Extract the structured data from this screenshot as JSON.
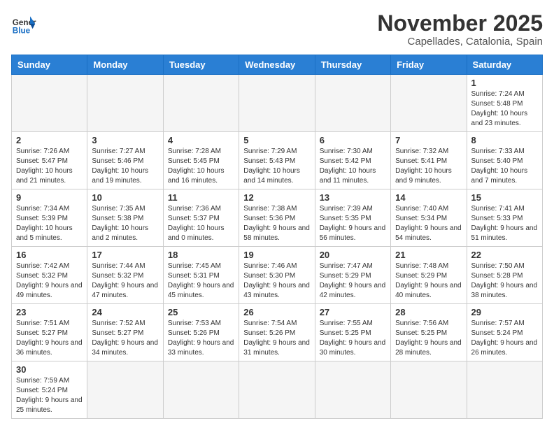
{
  "logo": {
    "text_general": "General",
    "text_blue": "Blue"
  },
  "title": {
    "month_year": "November 2025",
    "location": "Capellades, Catalonia, Spain"
  },
  "days_of_week": [
    "Sunday",
    "Monday",
    "Tuesday",
    "Wednesday",
    "Thursday",
    "Friday",
    "Saturday"
  ],
  "weeks": [
    [
      {
        "day": null,
        "info": null
      },
      {
        "day": null,
        "info": null
      },
      {
        "day": null,
        "info": null
      },
      {
        "day": null,
        "info": null
      },
      {
        "day": null,
        "info": null
      },
      {
        "day": null,
        "info": null
      },
      {
        "day": "1",
        "info": "Sunrise: 7:24 AM\nSunset: 5:48 PM\nDaylight: 10 hours and 23 minutes."
      }
    ],
    [
      {
        "day": "2",
        "info": "Sunrise: 7:26 AM\nSunset: 5:47 PM\nDaylight: 10 hours and 21 minutes."
      },
      {
        "day": "3",
        "info": "Sunrise: 7:27 AM\nSunset: 5:46 PM\nDaylight: 10 hours and 19 minutes."
      },
      {
        "day": "4",
        "info": "Sunrise: 7:28 AM\nSunset: 5:45 PM\nDaylight: 10 hours and 16 minutes."
      },
      {
        "day": "5",
        "info": "Sunrise: 7:29 AM\nSunset: 5:43 PM\nDaylight: 10 hours and 14 minutes."
      },
      {
        "day": "6",
        "info": "Sunrise: 7:30 AM\nSunset: 5:42 PM\nDaylight: 10 hours and 11 minutes."
      },
      {
        "day": "7",
        "info": "Sunrise: 7:32 AM\nSunset: 5:41 PM\nDaylight: 10 hours and 9 minutes."
      },
      {
        "day": "8",
        "info": "Sunrise: 7:33 AM\nSunset: 5:40 PM\nDaylight: 10 hours and 7 minutes."
      }
    ],
    [
      {
        "day": "9",
        "info": "Sunrise: 7:34 AM\nSunset: 5:39 PM\nDaylight: 10 hours and 5 minutes."
      },
      {
        "day": "10",
        "info": "Sunrise: 7:35 AM\nSunset: 5:38 PM\nDaylight: 10 hours and 2 minutes."
      },
      {
        "day": "11",
        "info": "Sunrise: 7:36 AM\nSunset: 5:37 PM\nDaylight: 10 hours and 0 minutes."
      },
      {
        "day": "12",
        "info": "Sunrise: 7:38 AM\nSunset: 5:36 PM\nDaylight: 9 hours and 58 minutes."
      },
      {
        "day": "13",
        "info": "Sunrise: 7:39 AM\nSunset: 5:35 PM\nDaylight: 9 hours and 56 minutes."
      },
      {
        "day": "14",
        "info": "Sunrise: 7:40 AM\nSunset: 5:34 PM\nDaylight: 9 hours and 54 minutes."
      },
      {
        "day": "15",
        "info": "Sunrise: 7:41 AM\nSunset: 5:33 PM\nDaylight: 9 hours and 51 minutes."
      }
    ],
    [
      {
        "day": "16",
        "info": "Sunrise: 7:42 AM\nSunset: 5:32 PM\nDaylight: 9 hours and 49 minutes."
      },
      {
        "day": "17",
        "info": "Sunrise: 7:44 AM\nSunset: 5:32 PM\nDaylight: 9 hours and 47 minutes."
      },
      {
        "day": "18",
        "info": "Sunrise: 7:45 AM\nSunset: 5:31 PM\nDaylight: 9 hours and 45 minutes."
      },
      {
        "day": "19",
        "info": "Sunrise: 7:46 AM\nSunset: 5:30 PM\nDaylight: 9 hours and 43 minutes."
      },
      {
        "day": "20",
        "info": "Sunrise: 7:47 AM\nSunset: 5:29 PM\nDaylight: 9 hours and 42 minutes."
      },
      {
        "day": "21",
        "info": "Sunrise: 7:48 AM\nSunset: 5:29 PM\nDaylight: 9 hours and 40 minutes."
      },
      {
        "day": "22",
        "info": "Sunrise: 7:50 AM\nSunset: 5:28 PM\nDaylight: 9 hours and 38 minutes."
      }
    ],
    [
      {
        "day": "23",
        "info": "Sunrise: 7:51 AM\nSunset: 5:27 PM\nDaylight: 9 hours and 36 minutes."
      },
      {
        "day": "24",
        "info": "Sunrise: 7:52 AM\nSunset: 5:27 PM\nDaylight: 9 hours and 34 minutes."
      },
      {
        "day": "25",
        "info": "Sunrise: 7:53 AM\nSunset: 5:26 PM\nDaylight: 9 hours and 33 minutes."
      },
      {
        "day": "26",
        "info": "Sunrise: 7:54 AM\nSunset: 5:26 PM\nDaylight: 9 hours and 31 minutes."
      },
      {
        "day": "27",
        "info": "Sunrise: 7:55 AM\nSunset: 5:25 PM\nDaylight: 9 hours and 30 minutes."
      },
      {
        "day": "28",
        "info": "Sunrise: 7:56 AM\nSunset: 5:25 PM\nDaylight: 9 hours and 28 minutes."
      },
      {
        "day": "29",
        "info": "Sunrise: 7:57 AM\nSunset: 5:24 PM\nDaylight: 9 hours and 26 minutes."
      }
    ],
    [
      {
        "day": "30",
        "info": "Sunrise: 7:59 AM\nSunset: 5:24 PM\nDaylight: 9 hours and 25 minutes."
      },
      {
        "day": null,
        "info": null
      },
      {
        "day": null,
        "info": null
      },
      {
        "day": null,
        "info": null
      },
      {
        "day": null,
        "info": null
      },
      {
        "day": null,
        "info": null
      },
      {
        "day": null,
        "info": null
      }
    ]
  ]
}
